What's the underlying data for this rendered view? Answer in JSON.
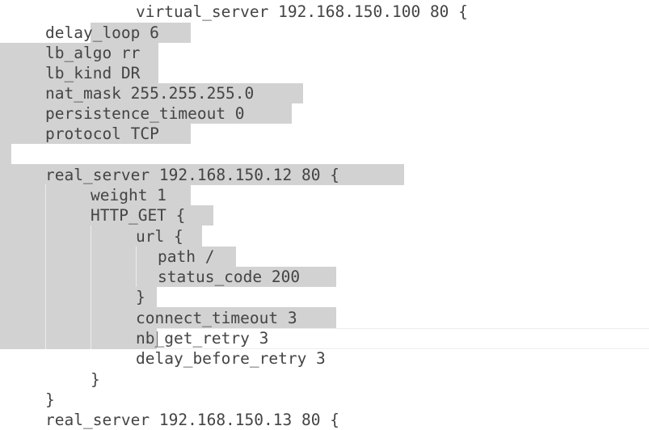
{
  "editor": {
    "lines": [
      "virtual_server 192.168.150.100 80 {",
      "delay_loop 6",
      "lb_algo rr",
      "lb_kind DR",
      "nat_mask 255.255.255.0",
      "persistence_timeout 0",
      "protocol TCP",
      "",
      "real_server 192.168.150.12 80 {",
      "weight 1",
      "HTTP_GET {",
      "url {",
      "path /",
      "status_code 200",
      "}",
      "connect_timeout 3",
      "nb_get_retry 3",
      "delay_before_retry 3",
      "}",
      "}",
      "real_server 192.168.150.13 80 {"
    ]
  }
}
